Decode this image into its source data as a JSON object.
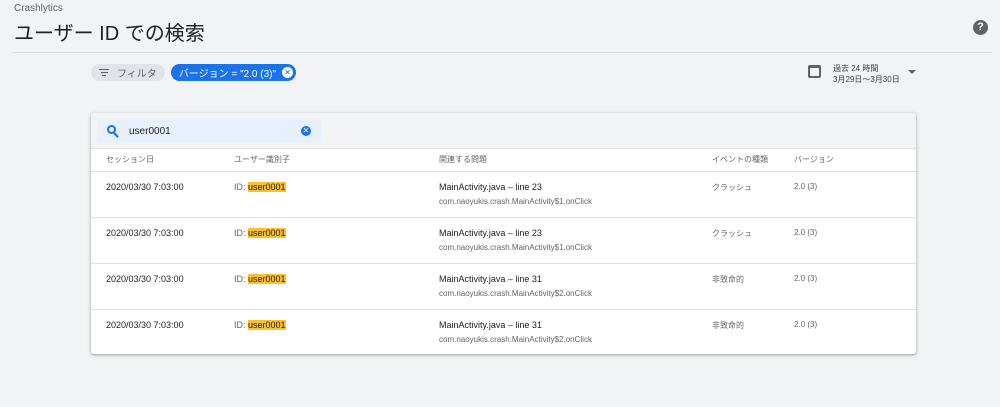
{
  "header": {
    "app_name": "Crashlytics",
    "title": "ユーザー ID での検索",
    "help_glyph": "?"
  },
  "filters": {
    "filter_label": "フィルタ",
    "version_chip": "バージョン = \"2.0 (3)\""
  },
  "date_range": {
    "line1": "過去 24 時間",
    "line2": "3月29日～3月30日"
  },
  "search": {
    "value": "user0001"
  },
  "table": {
    "headers": [
      "セッション日",
      "ユーザー識別子",
      "関連する問題",
      "イベントの種類",
      "バージョン"
    ],
    "id_prefix": "ID: ",
    "rows": [
      {
        "date": "2020/03/30 7:03:00",
        "user": "user0001",
        "issue": "MainActivity.java – line 23",
        "issue_sub": "com.naoyukis.crash.MainActivity$1.onClick",
        "type": "クラッシュ",
        "version": "2.0 (3)"
      },
      {
        "date": "2020/03/30 7:03:00",
        "user": "user0001",
        "issue": "MainActivity.java – line 23",
        "issue_sub": "com.naoyukis.crash.MainActivity$1.onClick",
        "type": "クラッシュ",
        "version": "2.0 (3)"
      },
      {
        "date": "2020/03/30 7:03:00",
        "user": "user0001",
        "issue": "MainActivity.java – line 31",
        "issue_sub": "com.naoyukis.crash.MainActivity$2.onClick",
        "type": "非致命的",
        "version": "2.0 (3)"
      },
      {
        "date": "2020/03/30 7:03:00",
        "user": "user0001",
        "issue": "MainActivity.java – line 31",
        "issue_sub": "com.naoyukis.crash.MainActivity$2.onClick",
        "type": "非致命的",
        "version": "2.0 (3)"
      }
    ]
  },
  "colors": {
    "accent": "#1a73e8",
    "highlight": "#fbc02d",
    "background": "#f1f3f4"
  }
}
